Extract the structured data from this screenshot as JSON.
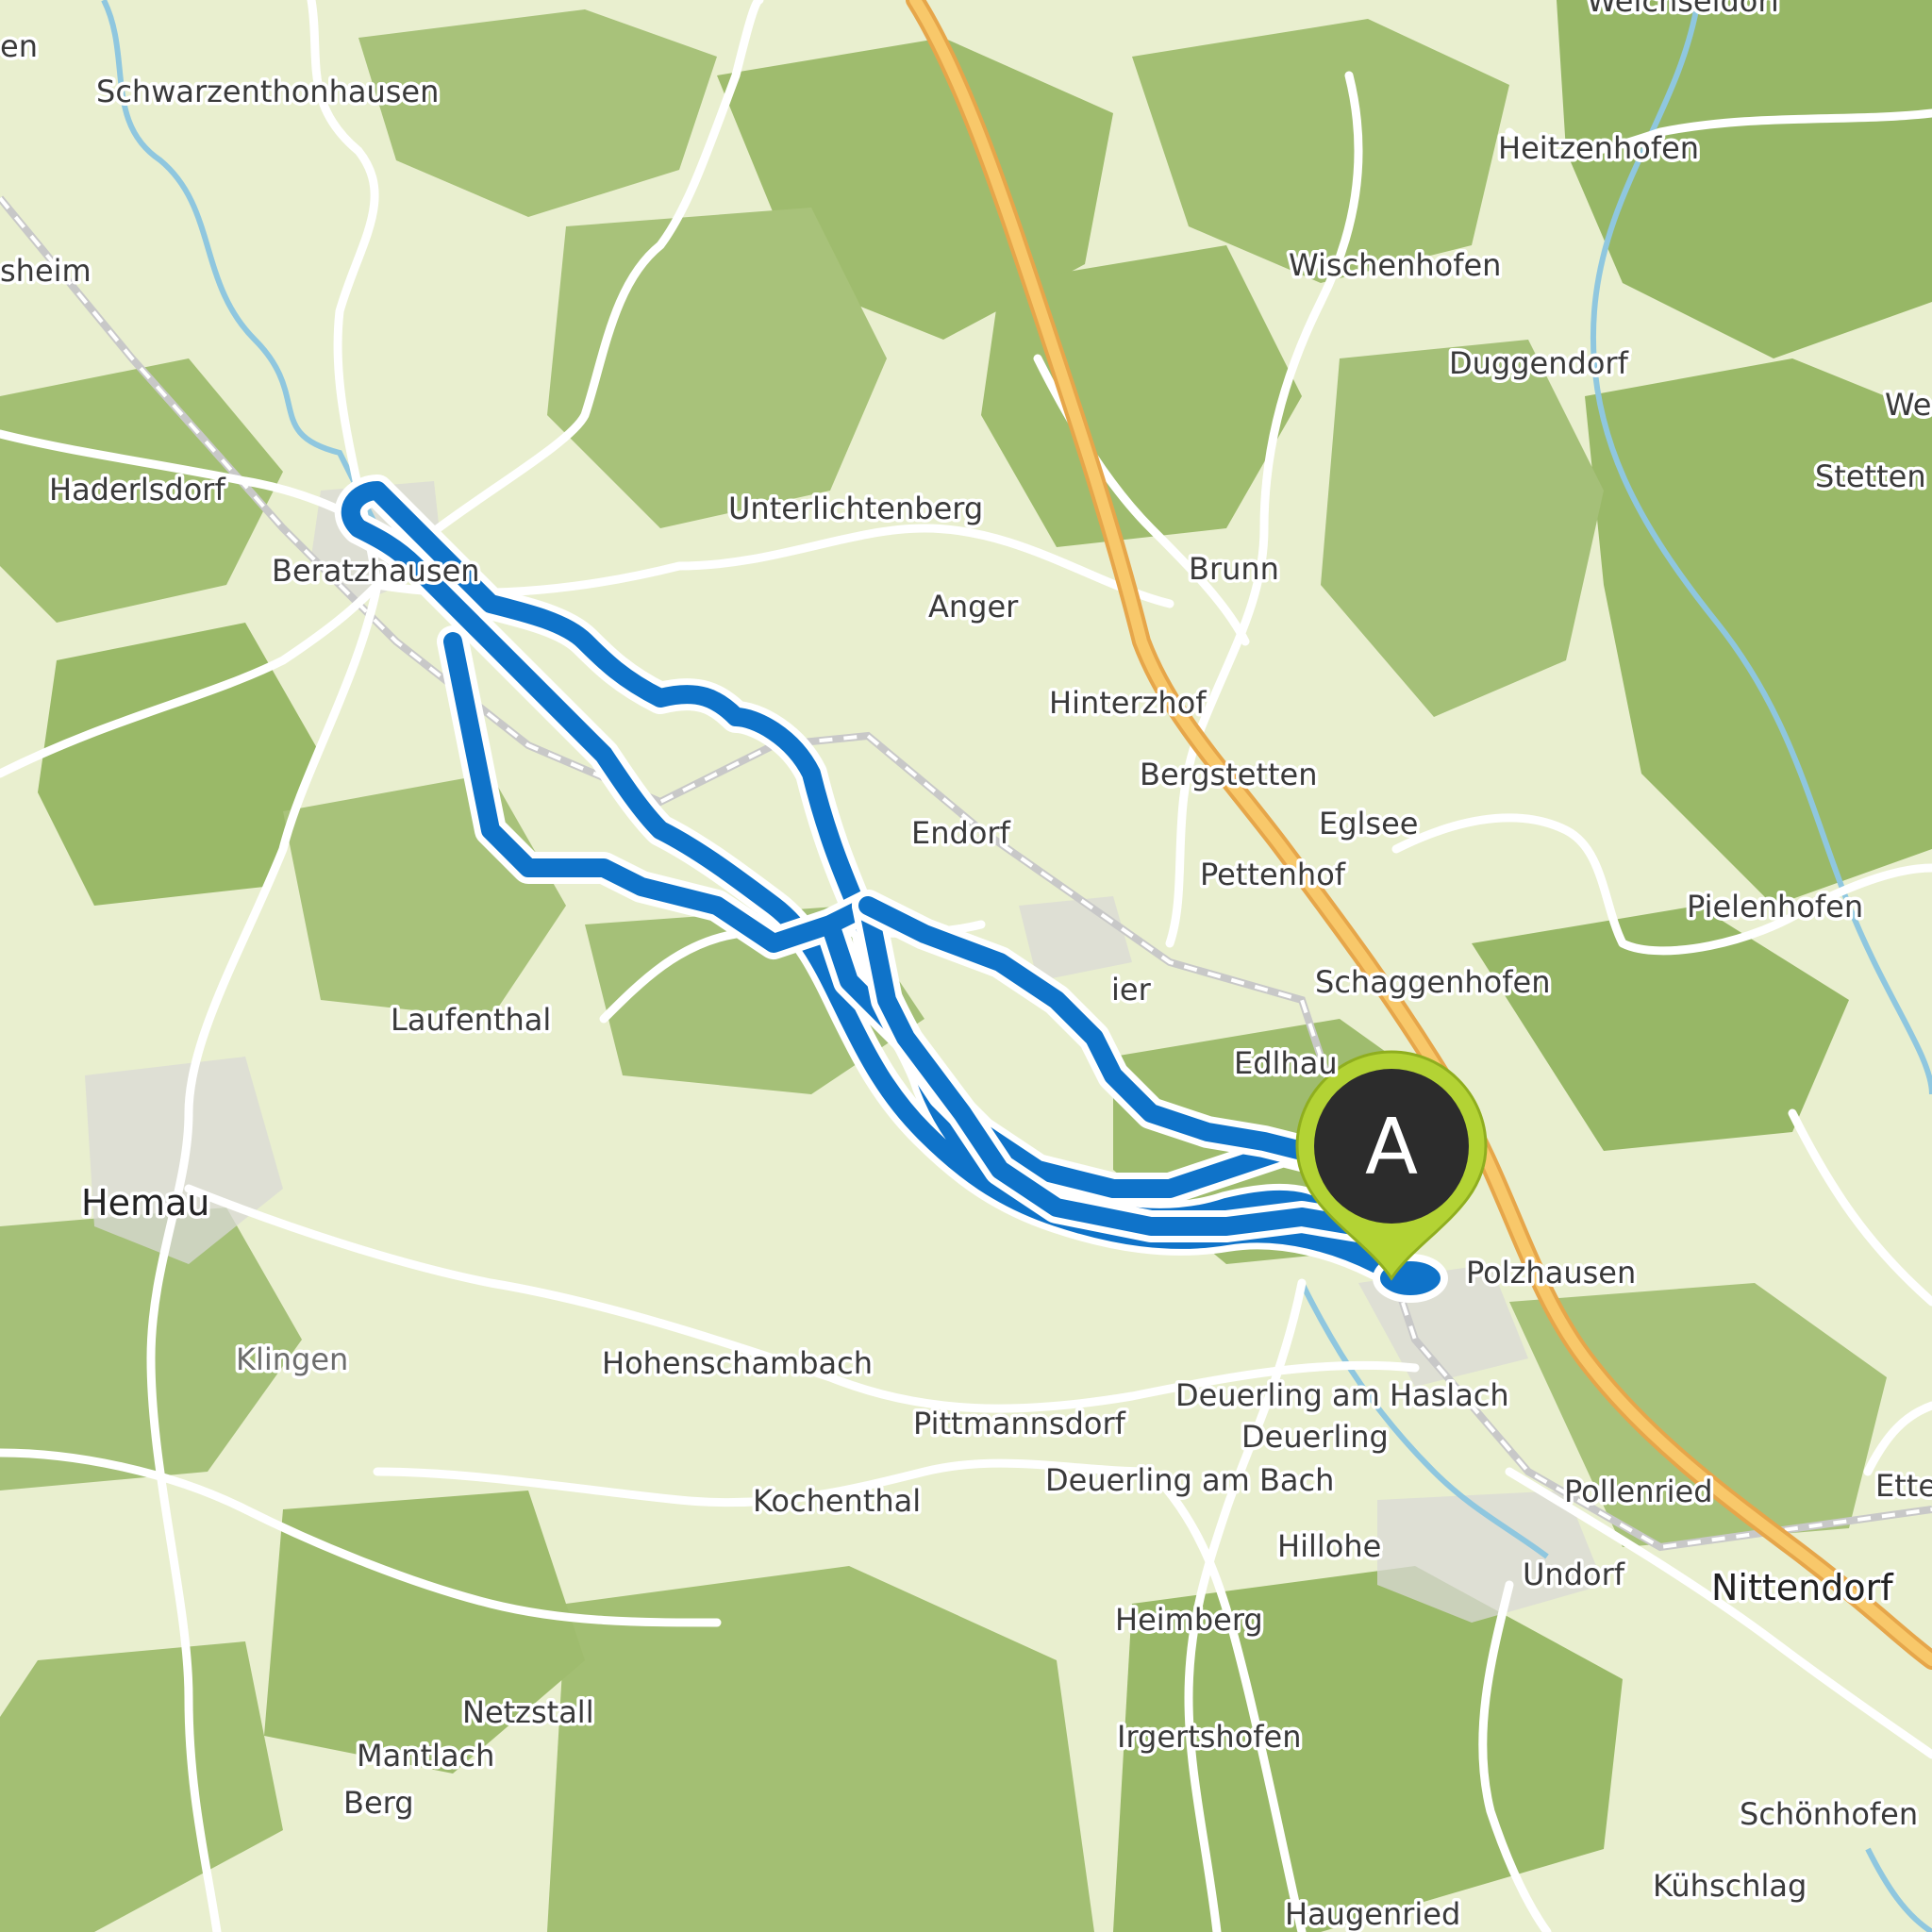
{
  "map": {
    "colors": {
      "land": "#e9efcf",
      "forest": "#9fbc6e",
      "forest_dark": "#8aab5c",
      "road": "#ffffff",
      "motorway": "#f3b94a",
      "river": "#8fc7df",
      "route": "#0f73c9",
      "route_casing": "#ffffff",
      "marker_fill": "#2c2c2c",
      "marker_ring": "#b3d334"
    },
    "route": {
      "name": ""
    },
    "start_marker": {
      "label": "A"
    },
    "places": [
      {
        "id": "schwarzenthonhausen",
        "name": "Schwarzenthonhausen",
        "size": "small"
      },
      {
        "id": "heitzenhofen",
        "name": "Heitzenhofen",
        "size": "small"
      },
      {
        "id": "wischenhofen",
        "name": "Wischenhofen",
        "size": "small"
      },
      {
        "id": "duggendorf",
        "name": "Duggendorf",
        "size": "small"
      },
      {
        "id": "stetten",
        "name": "Stetten",
        "size": "small"
      },
      {
        "id": "we",
        "name": "We",
        "size": "small"
      },
      {
        "id": "sheim",
        "name": "sheim",
        "size": "small"
      },
      {
        "id": "en",
        "name": "en",
        "size": "small"
      },
      {
        "id": "haderlsdorf",
        "name": "Haderlsdorf",
        "size": "small"
      },
      {
        "id": "beratzhausen",
        "name": "Beratzhausen",
        "size": "small"
      },
      {
        "id": "unterlichtenberg",
        "name": "Unterlichtenberg",
        "size": "small"
      },
      {
        "id": "anger",
        "name": "Anger",
        "size": "small"
      },
      {
        "id": "brunn",
        "name": "Brunn",
        "size": "small"
      },
      {
        "id": "hinterzhof",
        "name": "Hinterzhof",
        "size": "small"
      },
      {
        "id": "bergstetten",
        "name": "Bergstetten",
        "size": "small"
      },
      {
        "id": "eglsee",
        "name": "Eglsee",
        "size": "small"
      },
      {
        "id": "endorf",
        "name": "Endorf",
        "size": "small"
      },
      {
        "id": "pettenhof",
        "name": "Pettenhof",
        "size": "small"
      },
      {
        "id": "pielenhofen",
        "name": "Pielenhofen",
        "size": "small"
      },
      {
        "id": "schaggenhofen",
        "name": "Schaggenhofen",
        "size": "small"
      },
      {
        "id": "laufenthal",
        "name": "Laufenthal",
        "size": "small"
      },
      {
        "id": "edlhau",
        "name": "Edlhau",
        "size": "small"
      },
      {
        "id": "ier",
        "name": "ier",
        "size": "small"
      },
      {
        "id": "hemau",
        "name": "Hemau",
        "size": "big"
      },
      {
        "id": "polzhausen",
        "name": "Polzhausen",
        "size": "small"
      },
      {
        "id": "klingen",
        "name": "Klingen",
        "size": "grey"
      },
      {
        "id": "hohenschambach",
        "name": "Hohenschambach",
        "size": "small"
      },
      {
        "id": "deuerling-am-haslach",
        "name": "Deuerling am Haslach",
        "size": "small"
      },
      {
        "id": "pittmannsdorf",
        "name": "Pittmannsdorf",
        "size": "small"
      },
      {
        "id": "deuerling",
        "name": "Deuerling",
        "size": "small"
      },
      {
        "id": "deuerling-am-bach",
        "name": "Deuerling am Bach",
        "size": "small"
      },
      {
        "id": "kochenthal",
        "name": "Kochenthal",
        "size": "small"
      },
      {
        "id": "pollenried",
        "name": "Pollenried",
        "size": "small"
      },
      {
        "id": "ette",
        "name": "Ette",
        "size": "small"
      },
      {
        "id": "hillohe",
        "name": "Hillohe",
        "size": "small"
      },
      {
        "id": "undorf",
        "name": "Undorf",
        "size": "small"
      },
      {
        "id": "nittendorf",
        "name": "Nittendorf",
        "size": "big"
      },
      {
        "id": "heimberg",
        "name": "Heimberg",
        "size": "small"
      },
      {
        "id": "netzstall",
        "name": "Netzstall",
        "size": "small"
      },
      {
        "id": "mantlach",
        "name": "Mantlach",
        "size": "small"
      },
      {
        "id": "berg",
        "name": "Berg",
        "size": "small"
      },
      {
        "id": "irgertshofen",
        "name": "Irgertshofen",
        "size": "small"
      },
      {
        "id": "schonhofen",
        "name": "Schönhofen",
        "size": "small"
      },
      {
        "id": "kuhschlag",
        "name": "Kühschlag",
        "size": "small"
      },
      {
        "id": "haugenried",
        "name": "Haugenried",
        "size": "small"
      },
      {
        "id": "weichseldorf-partial",
        "name": "Weichseldorf",
        "size": "small"
      }
    ]
  }
}
